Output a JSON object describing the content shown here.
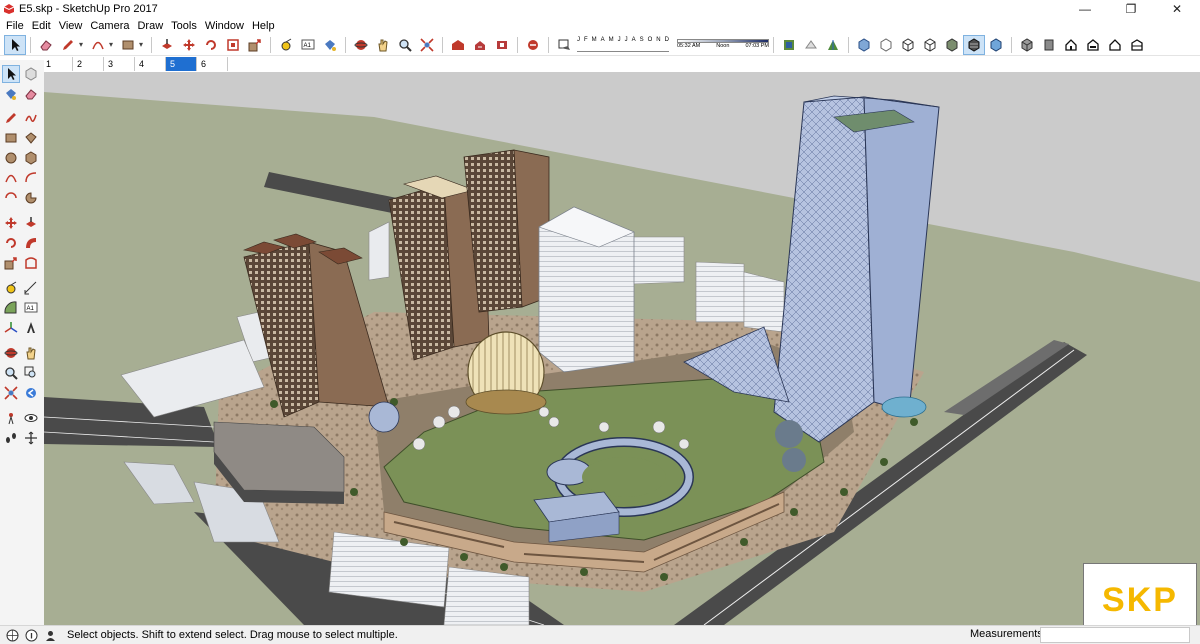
{
  "window": {
    "title": "E5.skp - SketchUp Pro 2017",
    "minimize_glyph": "—",
    "maximize_glyph": "❐",
    "close_glyph": "✕"
  },
  "menu": [
    "File",
    "Edit",
    "View",
    "Camera",
    "Draw",
    "Tools",
    "Window",
    "Help"
  ],
  "shadow_settings": {
    "months": [
      "J",
      "F",
      "M",
      "A",
      "M",
      "J",
      "J",
      "A",
      "S",
      "O",
      "N",
      "D"
    ],
    "times": [
      "05:32 AM",
      "Noon",
      "07:03 PM"
    ]
  },
  "scenes": {
    "tabs": [
      "1",
      "2",
      "3",
      "4",
      "5",
      "6"
    ],
    "active_index": 4
  },
  "status": {
    "message": "Select objects. Shift to extend select. Drag mouse to select multiple.",
    "measurements_label": "Measurements",
    "measurements_value": ""
  },
  "watermark": {
    "text": "SKP"
  },
  "colors": {
    "accent": "#1f6fd1",
    "ground": "#a7ae93",
    "road": "#4a4a4a",
    "sky": "#cbcbcb",
    "lawn": "#6f8a50",
    "glass": "#a9b8d6",
    "logo": "#f5b800"
  }
}
